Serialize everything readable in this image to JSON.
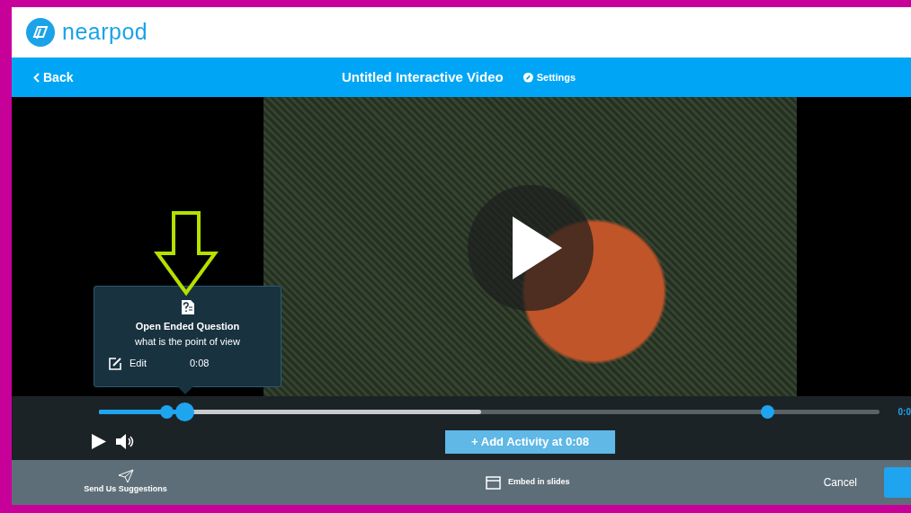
{
  "brand": {
    "name": "nearpod"
  },
  "toolbar": {
    "back": "Back",
    "title": "Untitled Interactive Video",
    "settings": "Settings"
  },
  "activity_popup": {
    "type": "Open Ended Question",
    "question": "what is the point of view",
    "edit": "Edit",
    "time": "0:08"
  },
  "timeline": {
    "progress": {
      "level": 0.11
    },
    "buffer": {
      "level": 0.49
    },
    "markers": [
      {
        "level": 0.086
      },
      {
        "level": 0.856
      }
    ],
    "time": "0:0"
  },
  "add_activity": {
    "label": "+ Add Activity at 0:08",
    "disabled": true
  },
  "footer": {
    "suggestions": "Send Us Suggestions",
    "embed": "Embed in slides",
    "cancel": "Cancel"
  }
}
